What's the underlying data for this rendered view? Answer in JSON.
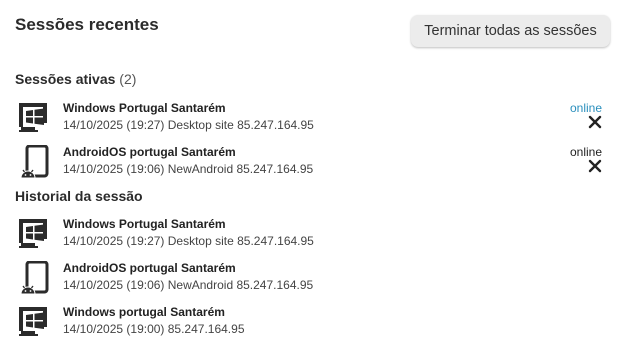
{
  "header": {
    "title": "Sessões recentes",
    "end_all_label": "Terminar todas as sessões"
  },
  "active_sessions": {
    "title": "Sessões ativas",
    "count": "(2)",
    "items": [
      {
        "name": "Windows Portugal Santarém",
        "details": "14/10/2025 (19:27) Desktop site 85.247.164.95",
        "status": "online",
        "status_color": "#2a8fbd",
        "icon": "windows-desktop-icon"
      },
      {
        "name": "AndroidOS portugal Santarém",
        "details": "14/10/2025 (19:06) NewAndroid 85.247.164.95",
        "status": "online",
        "status_color": "#222222",
        "icon": "android-phone-icon"
      }
    ]
  },
  "history": {
    "title": "Historial da sessão",
    "items": [
      {
        "name": "Windows Portugal Santarém",
        "details": "14/10/2025 (19:27) Desktop site 85.247.164.95",
        "icon": "windows-desktop-icon"
      },
      {
        "name": "AndroidOS portugal Santarém",
        "details": "14/10/2025 (19:06) NewAndroid 85.247.164.95",
        "icon": "android-phone-icon"
      },
      {
        "name": "Windows portugal Santarém",
        "details": "14/10/2025 (19:00) 85.247.164.95",
        "icon": "windows-desktop-icon"
      }
    ]
  },
  "colors": {
    "online_accent": "#2a8fbd",
    "button_bg": "#ececec",
    "icon": "#2b2b2b"
  }
}
